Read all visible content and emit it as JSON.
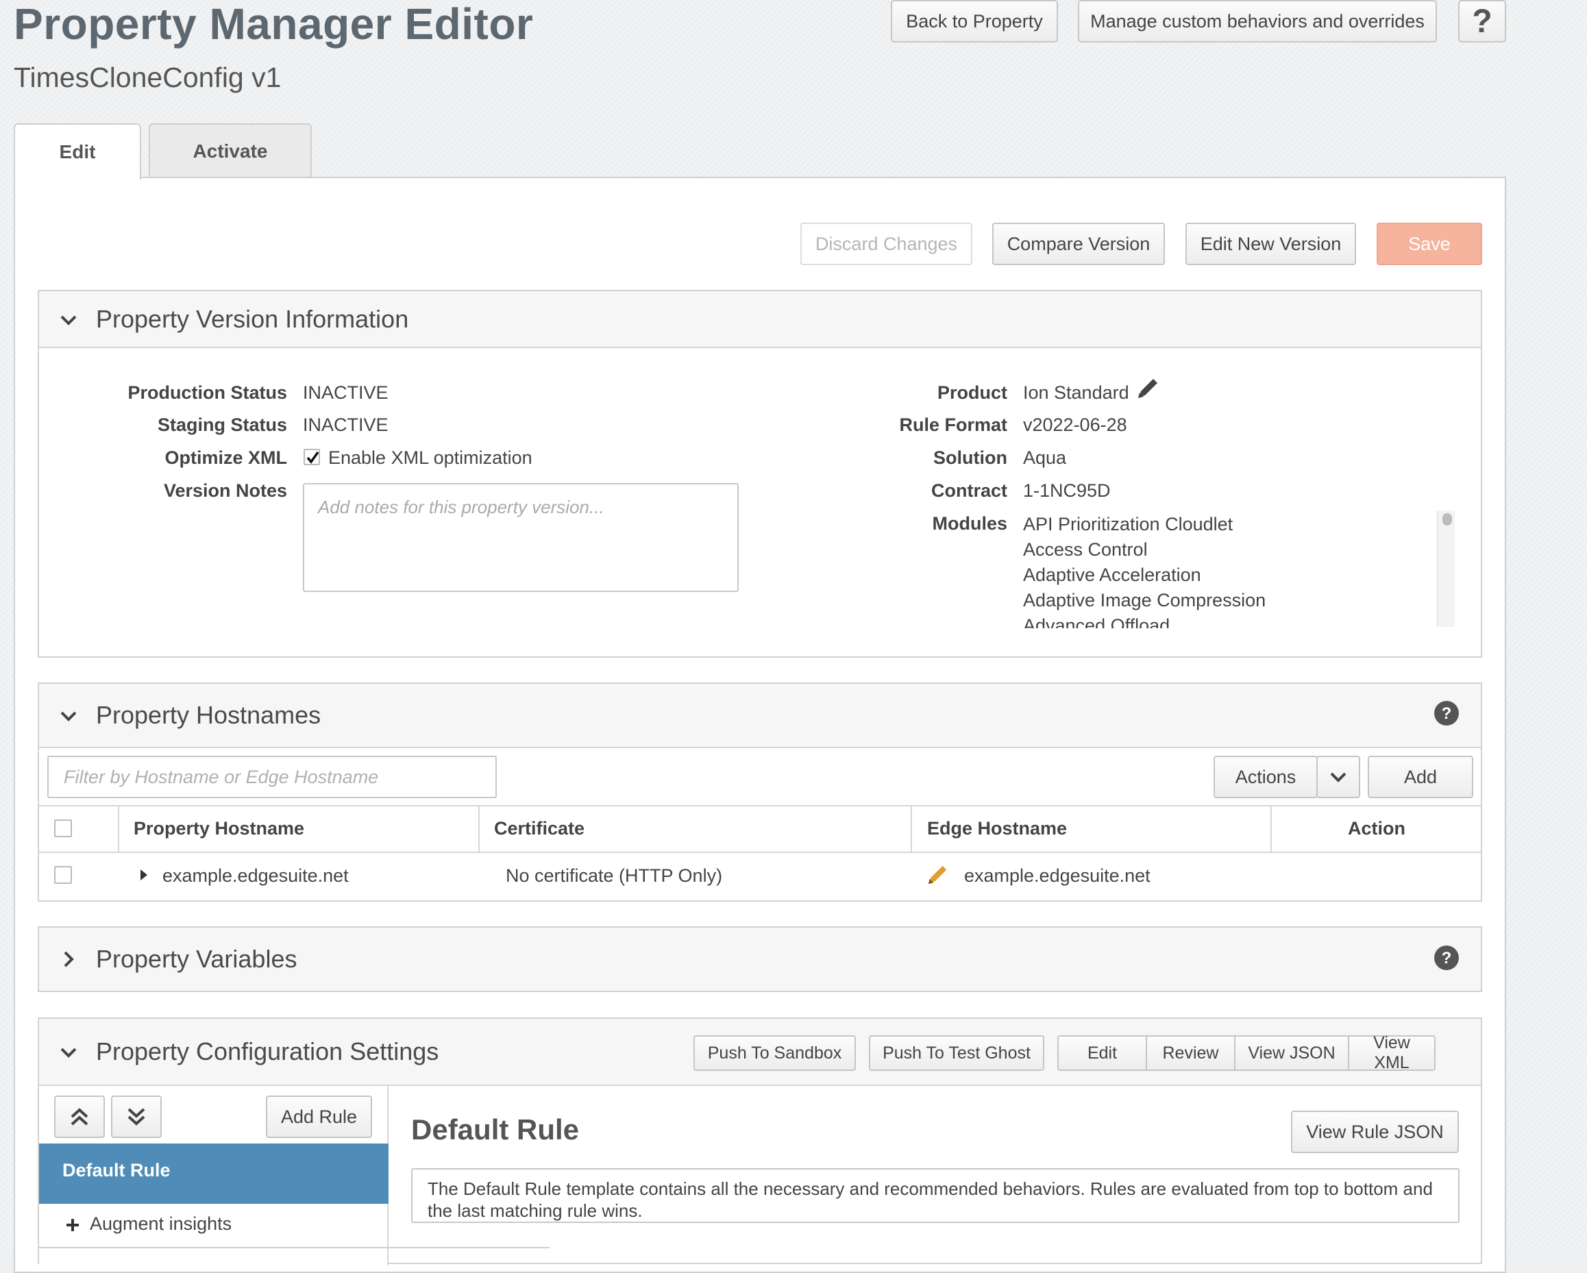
{
  "header": {
    "title": "Property Manager Editor",
    "subtitle": "TimesCloneConfig v1",
    "back_button": "Back to Property",
    "manage_button": "Manage custom behaviors and overrides",
    "help_label": "?"
  },
  "tabs": [
    {
      "label": "Edit",
      "active": true
    },
    {
      "label": "Activate",
      "active": false
    }
  ],
  "toolbar": {
    "discard": "Discard Changes",
    "compare": "Compare Version",
    "edit_new": "Edit New Version",
    "save": "Save"
  },
  "version_info": {
    "title": "Property Version Information",
    "production_status_label": "Production Status",
    "production_status": "INACTIVE",
    "staging_status_label": "Staging Status",
    "staging_status": "INACTIVE",
    "optimize_xml_label": "Optimize XML",
    "optimize_xml_checked": true,
    "optimize_xml_text": "Enable XML optimization",
    "version_notes_label": "Version Notes",
    "version_notes_placeholder": "Add notes for this property version...",
    "product_label": "Product",
    "product": "Ion Standard",
    "rule_format_label": "Rule Format",
    "rule_format": "v2022-06-28",
    "solution_label": "Solution",
    "solution": "Aqua",
    "contract_label": "Contract",
    "contract": "1-1NC95D",
    "modules_label": "Modules",
    "modules": [
      "API Prioritization Cloudlet",
      "Access Control",
      "Adaptive Acceleration",
      "Adaptive Image Compression",
      "Advanced Offload"
    ]
  },
  "hostnames": {
    "title": "Property Hostnames",
    "filter_placeholder": "Filter by Hostname or Edge Hostname",
    "actions_button": "Actions",
    "add_button": "Add",
    "columns": [
      "Property Hostname",
      "Certificate",
      "Edge Hostname",
      "Action"
    ],
    "rows": [
      {
        "hostname": "example.edgesuite.net",
        "certificate": "No certificate (HTTP Only)",
        "edge_hostname": "example.edgesuite.net"
      }
    ]
  },
  "variables": {
    "title": "Property Variables"
  },
  "config": {
    "title": "Property Configuration Settings",
    "push_sandbox": "Push To Sandbox",
    "push_test_ghost": "Push To Test Ghost",
    "edit": "Edit",
    "review": "Review",
    "view_json": "View JSON",
    "view_xml": "View XML",
    "add_rule": "Add Rule",
    "selected_rule": "Default Rule",
    "child_rule": "Augment insights",
    "rule_title": "Default Rule",
    "view_rule_json": "View Rule JSON",
    "rule_description": "The Default Rule template contains all the necessary and recommended behaviors. Rules are evaluated from top to bottom and the last matching rule wins."
  },
  "colors": {
    "save_bg": "#f6b39d",
    "selected_rule_bg": "#4f8db8",
    "pencil_orange": "#e0a030"
  }
}
